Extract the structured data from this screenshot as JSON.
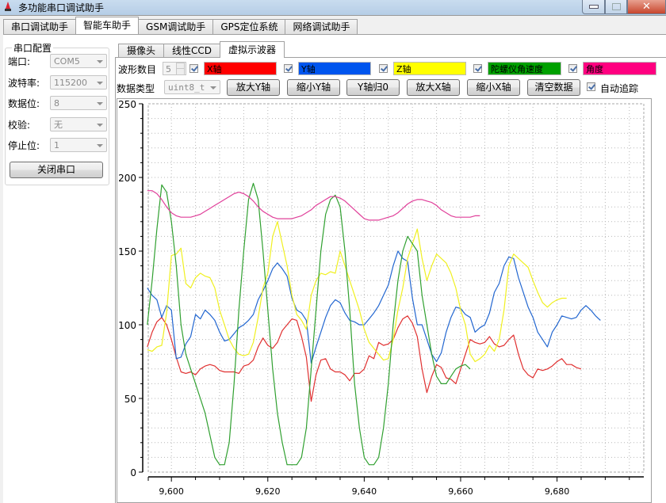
{
  "window": {
    "title": "多功能串口调试助手",
    "buttons": {
      "minimize": "minimize",
      "maximize": "maximize",
      "close": "✕"
    }
  },
  "top_tabs": [
    {
      "label": "串口调试助手",
      "active": false
    },
    {
      "label": "智能车助手",
      "active": true
    },
    {
      "label": "GSM调试助手",
      "active": false
    },
    {
      "label": "GPS定位系统",
      "active": false
    },
    {
      "label": "网络调试助手",
      "active": false
    }
  ],
  "serial_config": {
    "title": "串口配置",
    "fields": [
      {
        "label": "端口:",
        "value": "COM5"
      },
      {
        "label": "波特率:",
        "value": "115200"
      },
      {
        "label": "数据位:",
        "value": "8"
      },
      {
        "label": "校验:",
        "value": "无"
      },
      {
        "label": "停止位:",
        "value": "1"
      }
    ],
    "close_button": "关闭串口"
  },
  "inner_tabs": [
    {
      "label": "摄像头",
      "active": false
    },
    {
      "label": "线性CCD",
      "active": false
    },
    {
      "label": "虚拟示波器",
      "active": true
    }
  ],
  "scope": {
    "waveform_count_label": "波形数目",
    "waveform_count": "5",
    "channels": [
      {
        "name": "X轴",
        "color": "#ff0000",
        "checked": true,
        "text_color": "#000000"
      },
      {
        "name": "Y轴",
        "color": "#0055ee",
        "checked": true,
        "text_color": "#000000"
      },
      {
        "name": "Z轴",
        "color": "#ffff00",
        "checked": true,
        "text_color": "#000000"
      },
      {
        "name": "陀螺仪角速度",
        "color": "#00a000",
        "checked": true,
        "text_color": "#000000"
      },
      {
        "name": "角度",
        "color": "#ff0080",
        "checked": true,
        "text_color": "#000000"
      }
    ],
    "data_type_label": "数据类型",
    "data_type": "uint8_t",
    "buttons": {
      "zoom_in_y": "放大Y轴",
      "zoom_out_y": "缩小Y轴",
      "reset_y": "Y轴归0",
      "zoom_in_x": "放大X轴",
      "zoom_out_x": "缩小X轴",
      "clear": "清空数据"
    },
    "auto_track_label": "自动追踪",
    "auto_track": true
  },
  "chart_data": {
    "type": "line",
    "title": "",
    "xlabel": "",
    "ylabel": "",
    "xlim": [
      9595.2,
      9698
    ],
    "ylim": [
      0,
      250
    ],
    "grid": true,
    "legend": "none",
    "x_ticks": [
      9600,
      9620,
      9640,
      9660,
      9680
    ],
    "x_tick_labels": [
      "9,600",
      "9,620",
      "9,640",
      "9,660",
      "9,680"
    ],
    "y_ticks": [
      0,
      50,
      100,
      150,
      200,
      250
    ],
    "y_tick_labels": [
      "0",
      "50",
      "100",
      "150",
      "200",
      "250"
    ],
    "x_start": 9595,
    "x_step": 1,
    "series": [
      {
        "name": "X轴",
        "color": "#e03030",
        "values": [
          85,
          95,
          102,
          105,
          100,
          90,
          78,
          68,
          67,
          68,
          66,
          70,
          72,
          73,
          72,
          69,
          68,
          68,
          68,
          67,
          72,
          73,
          76,
          85,
          91,
          86,
          84,
          88,
          96,
          100,
          104,
          103,
          92,
          78,
          48,
          66,
          76,
          77,
          70,
          68,
          68,
          66,
          62,
          67,
          67,
          70,
          79,
          77,
          88,
          86,
          87,
          90,
          98,
          104,
          106,
          101,
          92,
          70,
          54,
          65,
          73,
          71,
          64,
          63,
          60,
          70,
          80,
          90,
          88,
          87,
          88,
          92,
          87,
          85,
          86,
          90,
          93,
          80,
          70,
          66,
          64,
          70,
          69,
          70,
          72,
          75,
          77,
          73,
          73,
          71,
          70
        ]
      },
      {
        "name": "Y轴",
        "color": "#2266d0",
        "values": [
          125,
          120,
          117,
          105,
          113,
          110,
          77,
          78,
          87,
          92,
          107,
          104,
          110,
          107,
          103,
          95,
          89,
          90,
          94,
          98,
          100,
          103,
          107,
          117,
          123,
          130,
          138,
          142,
          138,
          133,
          118,
          110,
          108,
          103,
          74,
          85,
          95,
          105,
          113,
          117,
          115,
          108,
          103,
          102,
          100,
          100,
          104,
          108,
          113,
          120,
          127,
          140,
          150,
          145,
          143,
          118,
          100,
          100,
          90,
          80,
          75,
          81,
          95,
          105,
          112,
          111,
          107,
          105,
          95,
          98,
          100,
          108,
          122,
          128,
          140,
          146,
          145,
          132,
          122,
          112,
          105,
          95,
          90,
          85,
          95,
          100,
          106,
          105,
          104,
          105,
          110,
          113,
          110,
          106,
          103
        ]
      },
      {
        "name": "Z轴",
        "color": "#f0f020",
        "values": [
          83,
          82,
          85,
          86,
          108,
          147,
          148,
          152,
          128,
          125,
          132,
          135,
          133,
          132,
          125,
          110,
          100,
          90,
          84,
          80,
          79,
          80,
          88,
          105,
          125,
          135,
          160,
          170,
          155,
          140,
          120,
          107,
          103,
          97,
          120,
          130,
          135,
          134,
          136,
          135,
          150,
          140,
          130,
          120,
          110,
          97,
          88,
          84,
          80,
          76,
          77,
          90,
          110,
          125,
          145,
          155,
          165,
          145,
          130,
          140,
          148,
          145,
          142,
          135,
          125,
          110,
          100,
          80,
          75,
          77,
          80,
          86,
          82,
          90,
          110,
          140,
          148,
          145,
          142,
          139,
          130,
          122,
          115,
          112,
          115,
          117,
          118,
          118
        ]
      },
      {
        "name": "陀螺仪角速度",
        "color": "#30a030",
        "values": [
          100,
          130,
          165,
          195,
          190,
          170,
          140,
          100,
          80,
          70,
          60,
          50,
          40,
          25,
          10,
          5,
          5,
          20,
          60,
          110,
          150,
          185,
          196,
          185,
          150,
          110,
          70,
          40,
          20,
          5,
          5,
          5,
          10,
          30,
          70,
          110,
          150,
          175,
          185,
          188,
          180,
          150,
          110,
          60,
          30,
          10,
          5,
          5,
          10,
          30,
          60,
          100,
          130,
          150,
          160,
          155,
          150,
          120,
          100,
          80,
          65,
          60,
          60,
          65,
          70,
          72,
          73,
          70
        ]
      },
      {
        "name": "角度",
        "color": "#e0409a",
        "values": [
          191,
          191,
          189,
          185,
          180,
          176,
          174,
          173,
          173,
          173,
          174,
          175,
          177,
          179,
          181,
          183,
          185,
          187,
          189,
          190,
          189,
          187,
          184,
          180,
          177,
          175,
          173,
          172,
          172,
          172,
          172,
          173,
          174,
          176,
          178,
          181,
          183,
          185,
          187,
          187,
          186,
          184,
          181,
          178,
          175,
          172,
          171,
          171,
          171,
          172,
          173,
          174,
          176,
          179,
          182,
          184,
          185,
          185,
          184,
          183,
          181,
          178,
          176,
          174,
          173,
          173,
          173,
          173,
          174,
          174
        ]
      }
    ]
  }
}
